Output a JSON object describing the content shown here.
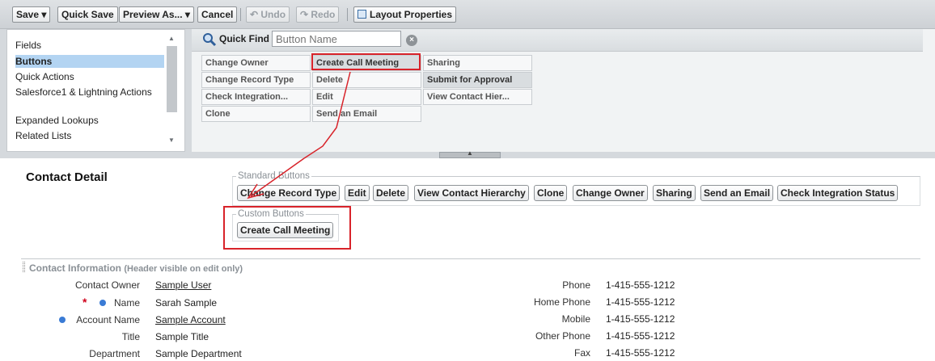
{
  "toolbar": {
    "save": "Save ▾",
    "quick_save": "Quick Save",
    "preview_as": "Preview As... ▾",
    "cancel": "Cancel",
    "undo": "Undo",
    "redo": "Redo",
    "layout_properties": "Layout Properties"
  },
  "categories": [
    {
      "label": "Fields"
    },
    {
      "label": "Buttons",
      "selected": true
    },
    {
      "label": "Quick Actions"
    },
    {
      "label": "Salesforce1 & Lightning Actions"
    },
    {
      "label": "Expanded Lookups"
    },
    {
      "label": "Related Lists"
    }
  ],
  "quick_find": {
    "label": "Quick Find",
    "placeholder": "Button Name"
  },
  "palette_buttons": {
    "col1": [
      "Change Owner",
      "Change Record Type",
      "Check Integration...",
      "Clone"
    ],
    "col2": [
      "Create Call Meeting",
      "Delete",
      "Edit",
      "Send an Email"
    ],
    "col3": [
      "Sharing",
      "Submit for Approval",
      "View Contact Hier..."
    ]
  },
  "layout": {
    "section_title": "Contact Detail",
    "standard_buttons_legend": "Standard Buttons",
    "standard_buttons": [
      "Change Record Type",
      "Edit",
      "Delete",
      "View Contact Hierarchy",
      "Clone",
      "Change Owner",
      "Sharing",
      "Send an Email",
      "Check Integration Status"
    ],
    "custom_buttons_legend": "Custom Buttons",
    "custom_buttons": [
      "Create Call Meeting"
    ]
  },
  "contact_info": {
    "title": "Contact Information",
    "subtitle": "(Header visible on edit only)",
    "left_fields": [
      {
        "label": "Contact Owner",
        "value": "Sample User"
      },
      {
        "label": "Name",
        "value": "Sarah Sample"
      },
      {
        "label": "Account Name",
        "value": "Sample Account"
      },
      {
        "label": "Title",
        "value": "Sample Title"
      },
      {
        "label": "Department",
        "value": "Sample Department"
      }
    ],
    "right_fields": [
      {
        "label": "Phone",
        "value": "1-415-555-1212"
      },
      {
        "label": "Home Phone",
        "value": "1-415-555-1212"
      },
      {
        "label": "Mobile",
        "value": "1-415-555-1212"
      },
      {
        "label": "Other Phone",
        "value": "1-415-555-1212"
      },
      {
        "label": "Fax",
        "value": "1-415-555-1212"
      }
    ]
  },
  "colors": {
    "highlight": "#d8232a",
    "selected_category": "#b3d4f2",
    "required_dot": "#3a7bd5"
  },
  "icons": [
    "dropdown-arrow-icon",
    "undo-icon",
    "redo-icon",
    "layout-properties-icon",
    "search-icon",
    "clear-icon",
    "scroll-up-icon",
    "scroll-down-icon",
    "collapse-icon"
  ]
}
